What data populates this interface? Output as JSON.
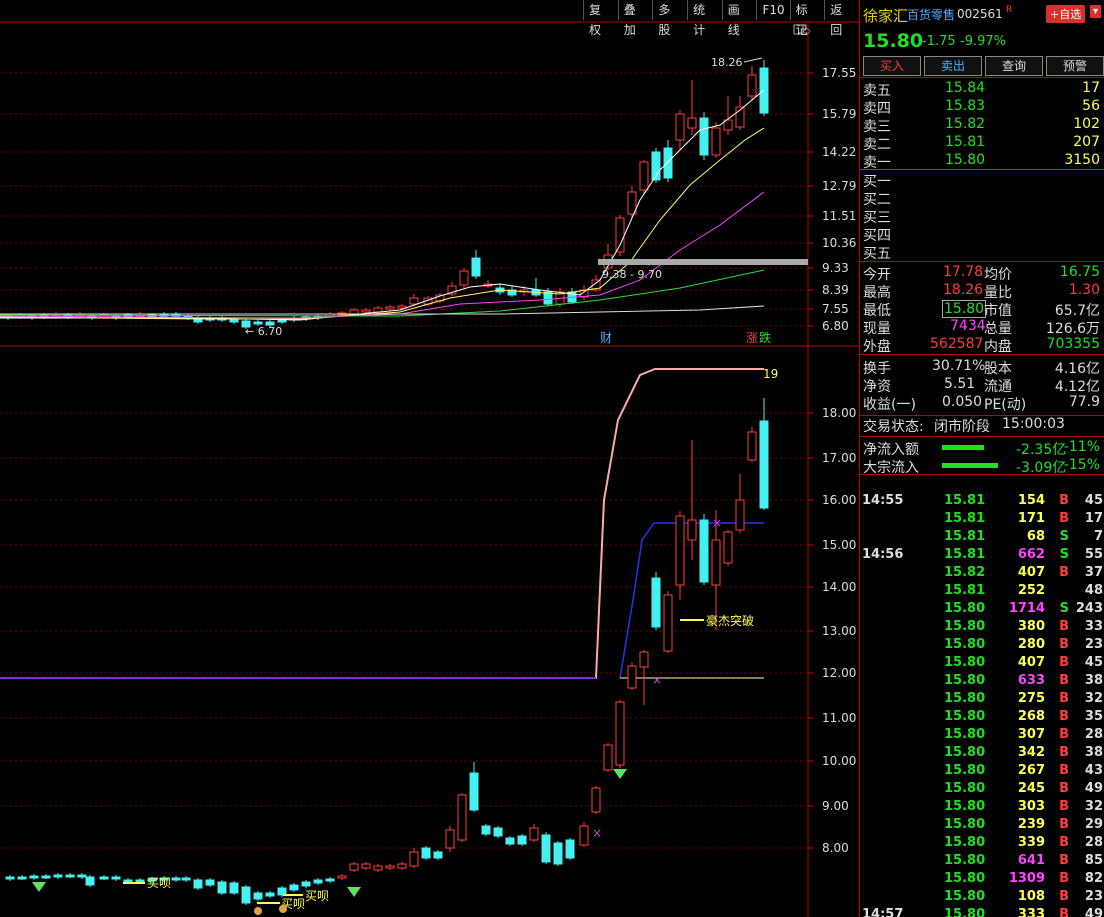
{
  "toolbar": {
    "buttons": [
      "复权",
      "叠加",
      "多股",
      "统计",
      "画线",
      "F10",
      "标记",
      "返回"
    ]
  },
  "chart": {
    "top_axis": [
      "17.55",
      "15.79",
      "14.22",
      "12.79",
      "11.51",
      "10.36",
      "9.33",
      "8.39",
      "7.55",
      "6.80"
    ],
    "bottom_axis": [
      "18.00",
      "17.00",
      "16.00",
      "15.00",
      "14.00",
      "13.00",
      "12.00",
      "11.00",
      "10.00",
      "9.00",
      "8.00"
    ],
    "high_label": "18.26",
    "low_label": "6.70",
    "range_label": "9.38 - 9.70",
    "cai": "财",
    "zhang": "涨",
    "die": "跌",
    "count19": "19",
    "signal1": "买呗",
    "signal2": "买呗",
    "signal3": "买呗",
    "breakout": "豪杰突破",
    "colors": {
      "up": "#ff3b3b",
      "down": "#44f0f0",
      "ma5": "#ffffff",
      "ma10": "#ffff66",
      "ma20": "#ff44ff",
      "ma60": "#33dd33",
      "ma120": "#dddddd"
    }
  },
  "header": {
    "name": "徐家汇",
    "sector": "百货零售",
    "code": "002561",
    "r": "R",
    "add": "+自选",
    "arrow": "▾"
  },
  "quote": {
    "price": "15.80",
    "change": "-1.75",
    "pct": "-9.97%"
  },
  "orders": [
    "买入",
    "卖出",
    "查询",
    "预警"
  ],
  "sell": [
    {
      "label": "卖五",
      "price": "15.84",
      "vol": "17"
    },
    {
      "label": "卖四",
      "price": "15.83",
      "vol": "56"
    },
    {
      "label": "卖三",
      "price": "15.82",
      "vol": "102"
    },
    {
      "label": "卖二",
      "price": "15.81",
      "vol": "207"
    },
    {
      "label": "卖一",
      "price": "15.80",
      "vol": "3150"
    }
  ],
  "buy": [
    {
      "label": "买一"
    },
    {
      "label": "买二"
    },
    {
      "label": "买三"
    },
    {
      "label": "买四"
    },
    {
      "label": "买五"
    }
  ],
  "stats": {
    "open_l": "今开",
    "open": "17.78",
    "avg_l": "均价",
    "avg": "16.75",
    "high_l": "最高",
    "high": "18.26",
    "qr_l": "量比",
    "qr": "1.30",
    "low_l": "最低",
    "low": "15.80",
    "mv_l": "市值",
    "mv": "65.7亿",
    "cur_l": "现量",
    "cur": "7434",
    "tot_l": "总量",
    "tot": "126.6万",
    "out_l": "外盘",
    "out": "562587",
    "in_l": "内盘",
    "in": "703355",
    "hs_l": "换手",
    "hs": "30.71%",
    "gb_l": "股本",
    "gb": "4.16亿",
    "jz_l": "净资",
    "jz": "5.51",
    "lt_l": "流通",
    "lt": "4.12亿",
    "sy_l": "收益(一)",
    "sy": "0.050",
    "pe_l": "PE(动)",
    "pe": "77.9"
  },
  "status": {
    "label": "交易状态:",
    "value": "闭市阶段",
    "time": "15:00:03"
  },
  "flow": [
    {
      "label": "净流入额",
      "amount": "-2.35亿",
      "pct": "-11%"
    },
    {
      "label": "大宗流入",
      "amount": "-3.09亿",
      "pct": "-15%"
    }
  ],
  "ticks": [
    {
      "t": "14:55",
      "p": "15.81",
      "v": "154",
      "s": "B",
      "n": "45",
      "c": "yl"
    },
    {
      "t": "",
      "p": "15.81",
      "v": "171",
      "s": "B",
      "n": "17",
      "c": "yl"
    },
    {
      "t": "",
      "p": "15.81",
      "v": "68",
      "s": "S",
      "n": "7",
      "c": "yl"
    },
    {
      "t": "14:56",
      "p": "15.81",
      "v": "662",
      "s": "S",
      "n": "55",
      "c": "mg"
    },
    {
      "t": "",
      "p": "15.82",
      "v": "407",
      "s": "B",
      "n": "37",
      "c": "yl"
    },
    {
      "t": "",
      "p": "15.81",
      "v": "252",
      "s": "",
      "n": "48",
      "c": "yl"
    },
    {
      "t": "",
      "p": "15.80",
      "v": "1714",
      "s": "S",
      "n": "243",
      "c": "mg"
    },
    {
      "t": "",
      "p": "15.80",
      "v": "380",
      "s": "B",
      "n": "33",
      "c": "yl"
    },
    {
      "t": "",
      "p": "15.80",
      "v": "280",
      "s": "B",
      "n": "23",
      "c": "yl"
    },
    {
      "t": "",
      "p": "15.80",
      "v": "407",
      "s": "B",
      "n": "45",
      "c": "yl"
    },
    {
      "t": "",
      "p": "15.80",
      "v": "633",
      "s": "B",
      "n": "38",
      "c": "mg"
    },
    {
      "t": "",
      "p": "15.80",
      "v": "275",
      "s": "B",
      "n": "32",
      "c": "yl"
    },
    {
      "t": "",
      "p": "15.80",
      "v": "268",
      "s": "B",
      "n": "35",
      "c": "yl"
    },
    {
      "t": "",
      "p": "15.80",
      "v": "307",
      "s": "B",
      "n": "28",
      "c": "yl"
    },
    {
      "t": "",
      "p": "15.80",
      "v": "342",
      "s": "B",
      "n": "38",
      "c": "yl"
    },
    {
      "t": "",
      "p": "15.80",
      "v": "267",
      "s": "B",
      "n": "43",
      "c": "yl"
    },
    {
      "t": "",
      "p": "15.80",
      "v": "245",
      "s": "B",
      "n": "49",
      "c": "yl"
    },
    {
      "t": "",
      "p": "15.80",
      "v": "303",
      "s": "B",
      "n": "32",
      "c": "yl"
    },
    {
      "t": "",
      "p": "15.80",
      "v": "239",
      "s": "B",
      "n": "29",
      "c": "yl"
    },
    {
      "t": "",
      "p": "15.80",
      "v": "339",
      "s": "B",
      "n": "28",
      "c": "yl"
    },
    {
      "t": "",
      "p": "15.80",
      "v": "641",
      "s": "B",
      "n": "85",
      "c": "mg"
    },
    {
      "t": "",
      "p": "15.80",
      "v": "1309",
      "s": "B",
      "n": "82",
      "c": "mg"
    },
    {
      "t": "",
      "p": "15.80",
      "v": "108",
      "s": "B",
      "n": "23",
      "c": "yl"
    },
    {
      "t": "14:57",
      "p": "15.80",
      "v": "333",
      "s": "B",
      "n": "49",
      "c": "yl"
    }
  ]
}
